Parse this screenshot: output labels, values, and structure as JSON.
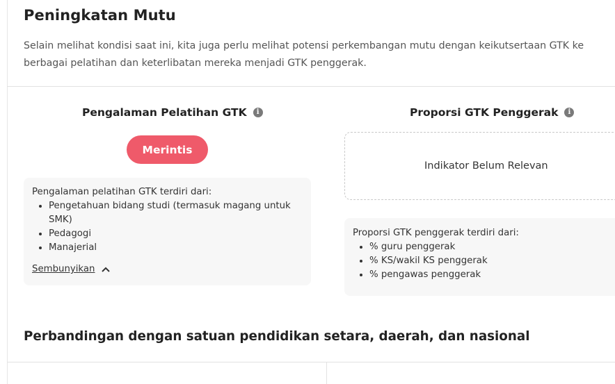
{
  "section": {
    "title": "Peningkatan Mutu",
    "description": "Selain melihat kondisi saat ini, kita juga perlu melihat potensi perkembangan mutu dengan keikutsertaan GTK ke berbagai pelatihan dan keterlibatan mereka menjadi GTK penggerak."
  },
  "left_card": {
    "title": "Pengalaman Pelatihan GTK",
    "info_icon": "info-icon",
    "badge": "Merintis",
    "badge_color": "#ef5a6a",
    "panel": {
      "intro": "Pengalaman pelatihan GTK terdiri dari:",
      "items": [
        "Pengetahuan bidang studi (termasuk magang untuk SMK)",
        "Pedagogi",
        "Manajerial"
      ],
      "toggle_label": "Sembunyikan",
      "toggle_icon": "chevron-up-icon"
    }
  },
  "right_card": {
    "title": "Proporsi GTK Penggerak",
    "info_icon": "info-icon",
    "placeholder": "Indikator Belum Relevan",
    "panel": {
      "intro": "Proporsi GTK penggerak terdiri dari:",
      "items": [
        "% guru penggerak",
        "% KS/wakil KS penggerak",
        "% pengawas penggerak"
      ]
    }
  },
  "comparison": {
    "title": "Perbandingan dengan satuan pendidikan setara, daerah, dan nasional"
  }
}
